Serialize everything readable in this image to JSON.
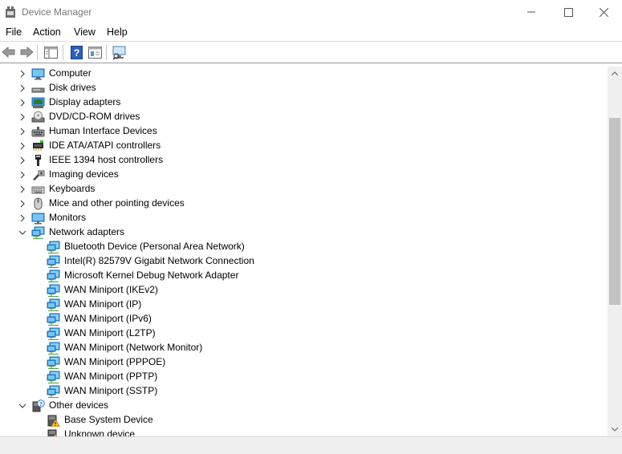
{
  "window": {
    "title": "Device Manager"
  },
  "menu": {
    "items": [
      "File",
      "Action",
      "View",
      "Help"
    ]
  },
  "tree": {
    "rows": [
      {
        "label": "Computer",
        "icon": "computer-icon",
        "expanded": false,
        "level": 0
      },
      {
        "label": "Disk drives",
        "icon": "disk-drive-icon",
        "expanded": false,
        "level": 0
      },
      {
        "label": "Display adapters",
        "icon": "display-adapter-icon",
        "expanded": false,
        "level": 0
      },
      {
        "label": "DVD/CD-ROM drives",
        "icon": "dvd-drive-icon",
        "expanded": false,
        "level": 0
      },
      {
        "label": "Human Interface Devices",
        "icon": "hid-icon",
        "expanded": false,
        "level": 0
      },
      {
        "label": "IDE ATA/ATAPI controllers",
        "icon": "ide-controller-icon",
        "expanded": false,
        "level": 0
      },
      {
        "label": "IEEE 1394 host controllers",
        "icon": "ieee1394-icon",
        "expanded": false,
        "level": 0
      },
      {
        "label": "Imaging devices",
        "icon": "camera-icon",
        "expanded": false,
        "level": 0
      },
      {
        "label": "Keyboards",
        "icon": "keyboard-icon",
        "expanded": false,
        "level": 0
      },
      {
        "label": "Mice and other pointing devices",
        "icon": "mouse-icon",
        "expanded": false,
        "level": 0
      },
      {
        "label": "Monitors",
        "icon": "monitor-icon",
        "expanded": false,
        "level": 0
      },
      {
        "label": "Network adapters",
        "icon": "network-adapter-icon",
        "expanded": true,
        "level": 0
      },
      {
        "label": "Bluetooth Device (Personal Area Network)",
        "icon": "network-adapter-icon",
        "level": 1
      },
      {
        "label": "Intel(R) 82579V Gigabit Network Connection",
        "icon": "network-adapter-icon",
        "level": 1
      },
      {
        "label": "Microsoft Kernel Debug Network Adapter",
        "icon": "network-adapter-icon",
        "level": 1
      },
      {
        "label": "WAN Miniport (IKEv2)",
        "icon": "network-adapter-icon",
        "level": 1
      },
      {
        "label": "WAN Miniport (IP)",
        "icon": "network-adapter-icon",
        "level": 1
      },
      {
        "label": "WAN Miniport (IPv6)",
        "icon": "network-adapter-icon",
        "level": 1
      },
      {
        "label": "WAN Miniport (L2TP)",
        "icon": "network-adapter-icon",
        "level": 1
      },
      {
        "label": "WAN Miniport (Network Monitor)",
        "icon": "network-adapter-icon",
        "level": 1
      },
      {
        "label": "WAN Miniport (PPPOE)",
        "icon": "network-adapter-icon",
        "level": 1
      },
      {
        "label": "WAN Miniport (PPTP)",
        "icon": "network-adapter-icon",
        "level": 1
      },
      {
        "label": "WAN Miniport (SSTP)",
        "icon": "network-adapter-icon",
        "level": 1
      },
      {
        "label": "Other devices",
        "icon": "unknown-device-icon",
        "expanded": true,
        "level": 0
      },
      {
        "label": "Base System Device",
        "icon": "warning-device-icon",
        "level": 1
      },
      {
        "label": "Unknown device",
        "icon": "warning-device-icon",
        "level": 1
      }
    ]
  },
  "colors": {
    "accent": "#2a8ad4",
    "warning": "#f2c230",
    "network": "#3aa0e0"
  }
}
